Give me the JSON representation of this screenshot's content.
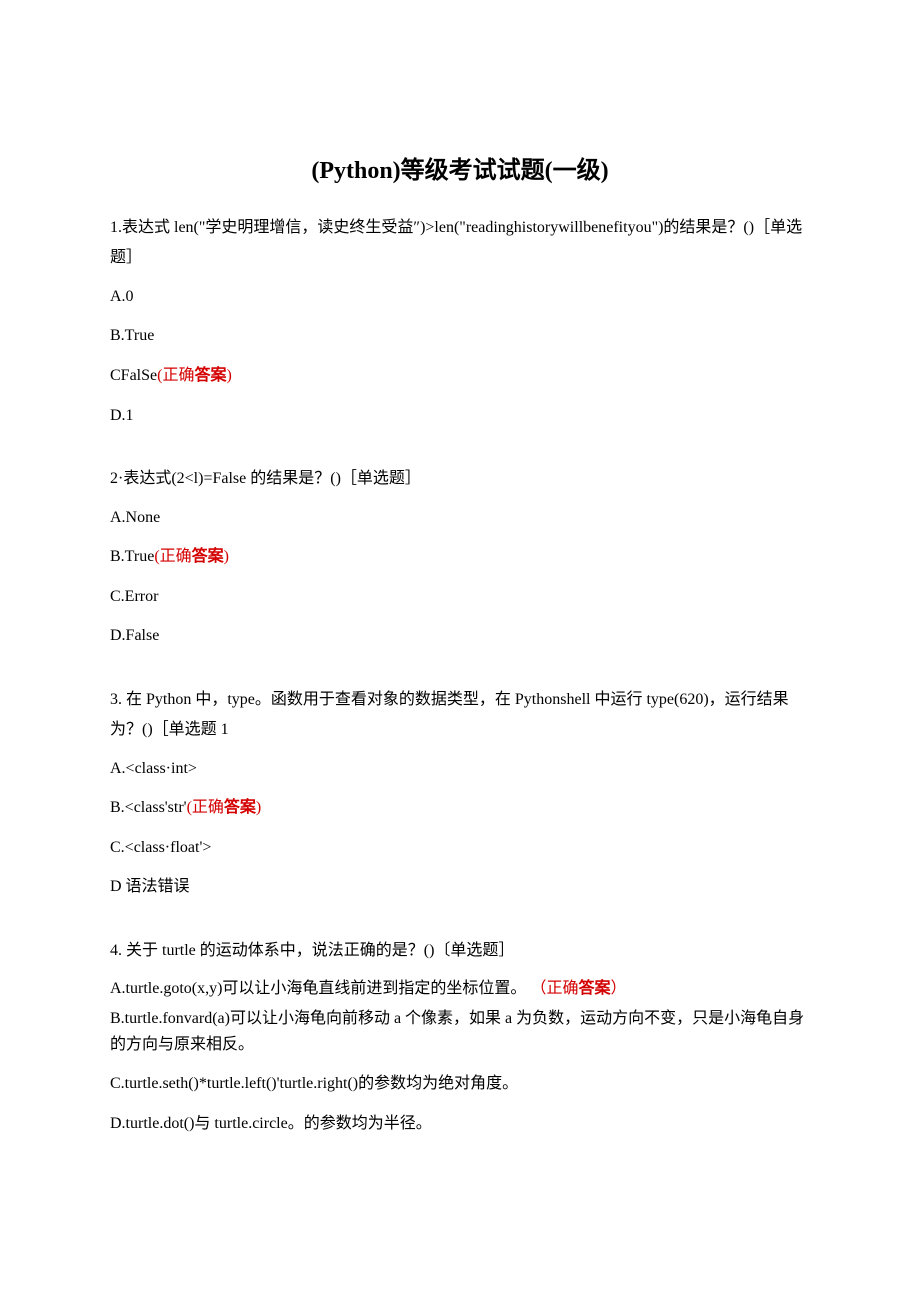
{
  "answer": {
    "open": "(正确",
    "label": "答案",
    "close": ")"
  },
  "answer2": {
    "open": "（正确",
    "label": "答案",
    "close": "）"
  },
  "title": "(Python)等级考试试题(一级)",
  "q1": {
    "stem": "1.表达式 len(\"学史明理增信，读史终生受益″)>len(\"readinghistorywillbenefityou\")的结果是？()［单选题］",
    "A": "A.0",
    "B": "B.True",
    "C": "CFalSe",
    "D": "D.1"
  },
  "q2": {
    "stem": "2·表达式(2<l)=False 的结果是？()［单选题］",
    "A": "A.None",
    "B": "B.True",
    "C": "C.Error",
    "D": "D.False"
  },
  "q3": {
    "stem": "3. 在 Python 中，type。函数用于查看对象的数据类型，在 Pythonshell 中运行 type(620)，运行结果为？()［单选题 1",
    "A": "A.<class·int>",
    "B": "B.<class'str'",
    "C": "C.<class·float'>",
    "D": "D 语法错误"
  },
  "q4": {
    "stem": "4. 关于 turtle 的运动体系中，说法正确的是？()〔单选题］",
    "A": "A.turtle.goto(x,y)可以让小海龟直线前进到指定的坐标位置。",
    "B": "B.turtle.fonvard(a)可以让小海龟向前移动 a 个像素，如果 a 为负数，运动方向不变，只是小海龟自身的方向与原来相反。",
    "C": "C.turtle.seth()*turtle.left()'turtle.right()的参数均为绝对角度。",
    "D": "D.turtle.dot()与 turtle.circle。的参数均为半径。"
  }
}
